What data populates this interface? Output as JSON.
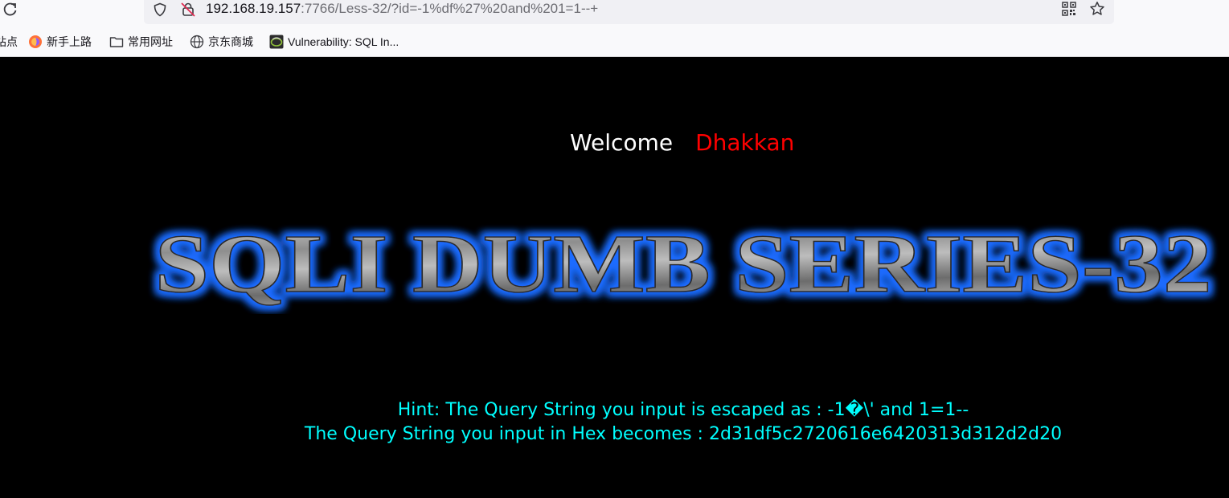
{
  "browser": {
    "url_host": "192.168.19.157",
    "url_rest": ":7766/Less-32/?id=-1%df%27%20and%201=1--+",
    "bookmarks": [
      {
        "label": "站点"
      },
      {
        "label": "新手上路"
      },
      {
        "label": "常用网址"
      },
      {
        "label": "京东商城"
      },
      {
        "label": "Vulnerability: SQL In..."
      }
    ]
  },
  "page": {
    "welcome": "Welcome",
    "username": "Dhakkan",
    "banner_title": "SQLI DUMB SERIES-32",
    "hint_line1": "Hint: The Query String you input is escaped as : -1�\\' and 1=1--",
    "hint_line2": "The Query String you input in Hex becomes : 2d31df5c2720616e6420313d312d2d20"
  },
  "colors": {
    "background": "#000000",
    "welcome": "#ffffff",
    "username": "#ff0000",
    "hint": "#00ffff",
    "banner_glow": "#1e6cff"
  }
}
